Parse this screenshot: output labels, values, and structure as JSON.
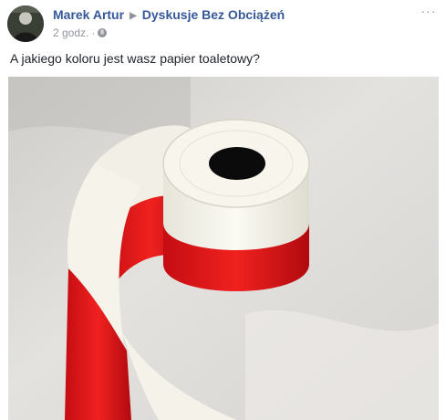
{
  "post": {
    "author": "Marek Artur",
    "separator_icon": "triangle-right-icon",
    "group": "Dyskusje Bez Obciążeń",
    "timestamp": "2 godz.",
    "dot": "·",
    "privacy_icon": "globe-icon",
    "more_label": "···",
    "text": "A jakiego koloru jest wasz papier toaletowy?"
  },
  "colors": {
    "link": "#365899",
    "meta": "#90949c",
    "text": "#1d2129",
    "red": "#e0141a",
    "white_paper": "#f3f1e6"
  }
}
